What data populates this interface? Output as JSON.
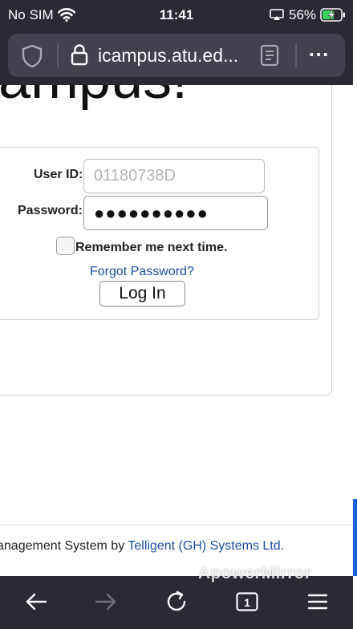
{
  "status_bar": {
    "carrier": "No SIM",
    "time": "11:41",
    "battery_percent": "56%"
  },
  "browser": {
    "url": "icampus.atu.ed...",
    "more_label": "⋯",
    "tab_count": "1"
  },
  "page": {
    "heading_fragment": "ampus!",
    "login": {
      "user_id_label": "User ID:",
      "user_id_placeholder": "01180738D",
      "password_label": "Password:",
      "password_mask": "●●●●●●●●●●",
      "remember_label": "Remember me next time.",
      "forgot_label": "Forgot Password?",
      "login_button": "Log In"
    },
    "footer": {
      "text": "anagement System by ",
      "company": "Telligent (GH) Systems Ltd."
    }
  },
  "watermark": "ApowerMirror",
  "colors": {
    "chrome_bg": "#2b2a33",
    "urlbar_bg": "#42414d",
    "link": "#1c4fa0",
    "battery_charging": "#3ad25f",
    "scroll_indicator": "#1a63d8"
  },
  "icons": [
    "wifi-icon",
    "screen-mirroring-icon",
    "battery-charging-icon",
    "shield-icon",
    "lock-icon",
    "reader-mode-icon",
    "more-icon",
    "back-arrow-icon",
    "forward-arrow-icon",
    "reload-icon",
    "tabs-icon",
    "menu-icon"
  ]
}
